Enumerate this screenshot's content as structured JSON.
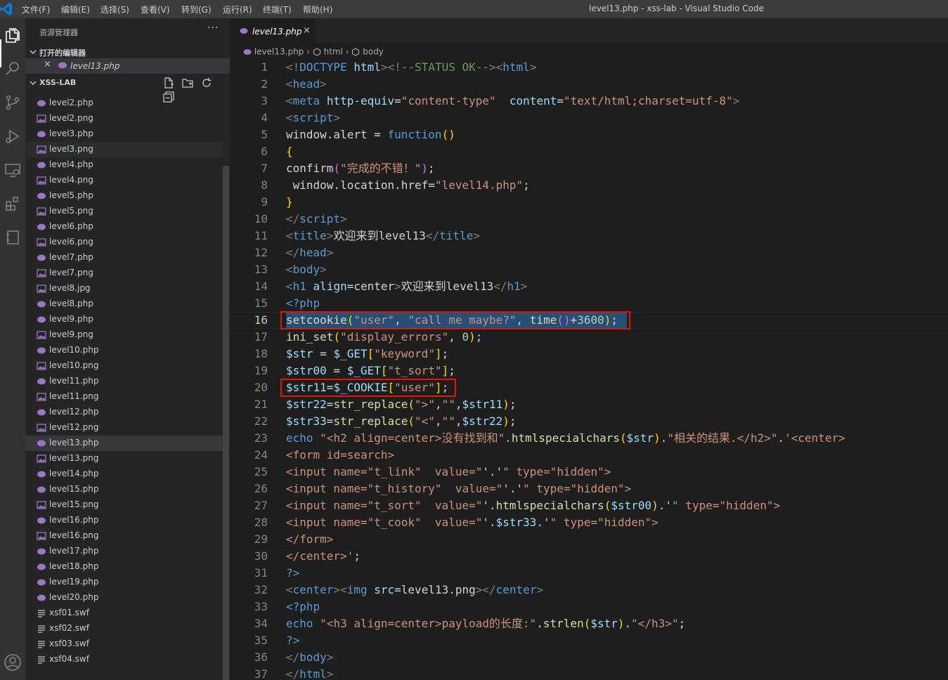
{
  "window": {
    "title": "level13.php - xss-lab - Visual Studio Code"
  },
  "menu": [
    "文件(F)",
    "编辑(E)",
    "选择(S)",
    "查看(V)",
    "转到(G)",
    "运行(R)",
    "终端(T)",
    "帮助(H)"
  ],
  "activity_bar": [
    "explorer-icon",
    "search-icon",
    "source-control-icon",
    "run-debug-icon",
    "remote-explorer-icon",
    "extensions-icon",
    "notebook-icon",
    "account-icon"
  ],
  "sidebar": {
    "title": "资源管理器",
    "more": "···",
    "open_editors": {
      "label": "打开的编辑器",
      "items": [
        {
          "name": "level13.php",
          "close": "×"
        }
      ]
    },
    "folder": {
      "label": "XSS-LAB"
    },
    "files": [
      {
        "name": "level2.php",
        "type": "php"
      },
      {
        "name": "level2.png",
        "type": "img"
      },
      {
        "name": "level3.php",
        "type": "php"
      },
      {
        "name": "level3.png",
        "type": "img"
      },
      {
        "name": "level4.php",
        "type": "php"
      },
      {
        "name": "level4.png",
        "type": "img"
      },
      {
        "name": "level5.php",
        "type": "php"
      },
      {
        "name": "level5.png",
        "type": "img"
      },
      {
        "name": "level6.php",
        "type": "php"
      },
      {
        "name": "level6.png",
        "type": "img"
      },
      {
        "name": "level7.php",
        "type": "php"
      },
      {
        "name": "level7.png",
        "type": "img"
      },
      {
        "name": "level8.jpg",
        "type": "img"
      },
      {
        "name": "level8.php",
        "type": "php"
      },
      {
        "name": "level9.php",
        "type": "php"
      },
      {
        "name": "level9.png",
        "type": "img"
      },
      {
        "name": "level10.php",
        "type": "php"
      },
      {
        "name": "level10.png",
        "type": "img"
      },
      {
        "name": "level11.php",
        "type": "php"
      },
      {
        "name": "level11.png",
        "type": "img"
      },
      {
        "name": "level12.php",
        "type": "php"
      },
      {
        "name": "level12.png",
        "type": "img"
      },
      {
        "name": "level13.php",
        "type": "php"
      },
      {
        "name": "level13.png",
        "type": "img"
      },
      {
        "name": "level14.php",
        "type": "php"
      },
      {
        "name": "level15.php",
        "type": "php"
      },
      {
        "name": "level15.png",
        "type": "img"
      },
      {
        "name": "level16.php",
        "type": "php"
      },
      {
        "name": "level16.png",
        "type": "img"
      },
      {
        "name": "level17.php",
        "type": "php"
      },
      {
        "name": "level18.php",
        "type": "php"
      },
      {
        "name": "level19.php",
        "type": "php"
      },
      {
        "name": "level20.php",
        "type": "php"
      },
      {
        "name": "xsf01.swf",
        "type": "swf"
      },
      {
        "name": "xsf02.swf",
        "type": "swf"
      },
      {
        "name": "xsf03.swf",
        "type": "swf"
      },
      {
        "name": "xsf04.swf",
        "type": "swf"
      }
    ],
    "selected_file": "level13.php",
    "hovered_file": "level3.png"
  },
  "editor": {
    "tab": {
      "name": "level13.php",
      "close": "×"
    },
    "breadcrumb": [
      "level13.php",
      "html",
      "body"
    ],
    "current_line": 16,
    "highlighted_lines": [
      16,
      20
    ],
    "lines": [
      [
        [
          "tg",
          "<!"
        ],
        [
          "tn",
          "DOCTYPE"
        ],
        [
          "pl",
          " "
        ],
        [
          "at",
          "html"
        ],
        [
          "tg",
          "><!--"
        ],
        [
          "cm",
          "STATUS OK"
        ],
        [
          "tg",
          "--><"
        ],
        [
          "tn",
          "html"
        ],
        [
          "tg",
          ">"
        ]
      ],
      [
        [
          "tg",
          "<"
        ],
        [
          "tn",
          "head"
        ],
        [
          "tg",
          ">"
        ]
      ],
      [
        [
          "tg",
          "<"
        ],
        [
          "tn",
          "meta"
        ],
        [
          "pl",
          " "
        ],
        [
          "at",
          "http-equiv"
        ],
        [
          "pl",
          "="
        ],
        [
          "st",
          "\"content-type\""
        ],
        [
          "pl",
          "  "
        ],
        [
          "at",
          "content"
        ],
        [
          "pl",
          "="
        ],
        [
          "st",
          "\"text/html;charset=utf-8\""
        ],
        [
          "tg",
          ">"
        ]
      ],
      [
        [
          "tg",
          "<"
        ],
        [
          "tn",
          "script"
        ],
        [
          "tg",
          ">"
        ]
      ],
      [
        [
          "pl",
          "window.alert = "
        ],
        [
          "kw",
          "function"
        ],
        [
          "br1",
          "()"
        ]
      ],
      [
        [
          "br1",
          "{"
        ]
      ],
      [
        [
          "pl",
          "confirm"
        ],
        [
          "br2",
          "("
        ],
        [
          "st",
          "\"完成的不错！\""
        ],
        [
          "br2",
          ")"
        ],
        [
          "pl",
          ";"
        ]
      ],
      [
        [
          "pl",
          " window.location.href="
        ],
        [
          "st",
          "\"level14.php\""
        ],
        [
          "pl",
          ";"
        ]
      ],
      [
        [
          "br1",
          "}"
        ]
      ],
      [
        [
          "tg",
          "</"
        ],
        [
          "tn",
          "script"
        ],
        [
          "tg",
          ">"
        ]
      ],
      [
        [
          "tg",
          "<"
        ],
        [
          "tn",
          "title"
        ],
        [
          "tg",
          ">"
        ],
        [
          "pl",
          "欢迎来到level13"
        ],
        [
          "tg",
          "</"
        ],
        [
          "tn",
          "title"
        ],
        [
          "tg",
          ">"
        ]
      ],
      [
        [
          "tg",
          "</"
        ],
        [
          "tn",
          "head"
        ],
        [
          "tg",
          ">"
        ]
      ],
      [
        [
          "tg",
          "<"
        ],
        [
          "tn",
          "body"
        ],
        [
          "tg",
          ">"
        ]
      ],
      [
        [
          "tg",
          "<"
        ],
        [
          "tn",
          "h1"
        ],
        [
          "pl",
          " "
        ],
        [
          "at",
          "align"
        ],
        [
          "pl",
          "=center"
        ],
        [
          "tg",
          ">"
        ],
        [
          "pl",
          "欢迎来到level13"
        ],
        [
          "tg",
          "</"
        ],
        [
          "tn",
          "h1"
        ],
        [
          "tg",
          ">"
        ]
      ],
      [
        [
          "ph",
          "<?php"
        ]
      ],
      [
        [
          "fn",
          "setcookie"
        ],
        [
          "br1",
          "("
        ],
        [
          "st",
          "\"user\""
        ],
        [
          "pl",
          ", "
        ],
        [
          "st",
          "\"call me maybe?\""
        ],
        [
          "pl",
          ", "
        ],
        [
          "fn",
          "time"
        ],
        [
          "br2",
          "()"
        ],
        [
          "pl",
          "+"
        ],
        [
          "nu",
          "3600"
        ],
        [
          "br1",
          ")"
        ],
        [
          "pl",
          ";"
        ]
      ],
      [
        [
          "fn",
          "ini_set"
        ],
        [
          "br1",
          "("
        ],
        [
          "st",
          "\"display_errors\""
        ],
        [
          "pl",
          ", "
        ],
        [
          "nu",
          "0"
        ],
        [
          "br1",
          ")"
        ],
        [
          "pl",
          ";"
        ]
      ],
      [
        [
          "vr",
          "$str"
        ],
        [
          "pl",
          " = "
        ],
        [
          "vr",
          "$_GET"
        ],
        [
          "br1",
          "["
        ],
        [
          "st",
          "\"keyword\""
        ],
        [
          "br1",
          "]"
        ],
        [
          "pl",
          ";"
        ]
      ],
      [
        [
          "vr",
          "$str00"
        ],
        [
          "pl",
          " = "
        ],
        [
          "vr",
          "$_GET"
        ],
        [
          "br1",
          "["
        ],
        [
          "st",
          "\"t_sort\""
        ],
        [
          "br1",
          "]"
        ],
        [
          "pl",
          ";"
        ]
      ],
      [
        [
          "vr",
          "$str11"
        ],
        [
          "pl",
          "="
        ],
        [
          "vr",
          "$_COOKIE"
        ],
        [
          "br1",
          "["
        ],
        [
          "st",
          "\"user\""
        ],
        [
          "br1",
          "]"
        ],
        [
          "pl",
          ";"
        ]
      ],
      [
        [
          "vr",
          "$str22"
        ],
        [
          "pl",
          "="
        ],
        [
          "fn",
          "str_replace"
        ],
        [
          "br1",
          "("
        ],
        [
          "st",
          "\">\""
        ],
        [
          "pl",
          ","
        ],
        [
          "st",
          "\"\""
        ],
        [
          "pl",
          ","
        ],
        [
          "vr",
          "$str11"
        ],
        [
          "br1",
          ")"
        ],
        [
          "pl",
          ";"
        ]
      ],
      [
        [
          "vr",
          "$str33"
        ],
        [
          "pl",
          "="
        ],
        [
          "fn",
          "str_replace"
        ],
        [
          "br1",
          "("
        ],
        [
          "st",
          "\"<\""
        ],
        [
          "pl",
          ","
        ],
        [
          "st",
          "\"\""
        ],
        [
          "pl",
          ","
        ],
        [
          "vr",
          "$str22"
        ],
        [
          "br1",
          ")"
        ],
        [
          "pl",
          ";"
        ]
      ],
      [
        [
          "kw",
          "echo"
        ],
        [
          "pl",
          " "
        ],
        [
          "st",
          "\"<h2 align=center>没有找到和\""
        ],
        [
          "pl",
          "."
        ],
        [
          "fn",
          "htmlspecialchars"
        ],
        [
          "br1",
          "("
        ],
        [
          "vr",
          "$str"
        ],
        [
          "br1",
          ")"
        ],
        [
          "pl",
          "."
        ],
        [
          "st",
          "\"相关的结果.</h2>\""
        ],
        [
          "pl",
          "."
        ],
        [
          "st",
          "'<center>"
        ]
      ],
      [
        [
          "st",
          "<form id=search>"
        ]
      ],
      [
        [
          "st",
          "<input name=\"t_link\"  value=\""
        ],
        [
          "pl",
          "'.'"
        ],
        [
          "st",
          "\" type=\"hidden\">"
        ]
      ],
      [
        [
          "st",
          "<input name=\"t_history\"  value=\""
        ],
        [
          "pl",
          "'.'"
        ],
        [
          "st",
          "\" type=\"hidden\">"
        ]
      ],
      [
        [
          "st",
          "<input name=\"t_sort\"  value=\""
        ],
        [
          "pl",
          "'."
        ],
        [
          "fn",
          "htmlspecialchars"
        ],
        [
          "br1",
          "("
        ],
        [
          "vr",
          "$str00"
        ],
        [
          "br1",
          ")"
        ],
        [
          "pl",
          ".'"
        ],
        [
          "st",
          "\" type=\"hidden\">"
        ]
      ],
      [
        [
          "st",
          "<input name=\"t_cook\"  value=\""
        ],
        [
          "pl",
          "'."
        ],
        [
          "vr",
          "$str33"
        ],
        [
          "pl",
          ".'"
        ],
        [
          "st",
          "\" type=\"hidden\">"
        ]
      ],
      [
        [
          "st",
          "</form>"
        ]
      ],
      [
        [
          "st",
          "</center>'"
        ],
        [
          "pl",
          ";"
        ]
      ],
      [
        [
          "ph",
          "?>"
        ]
      ],
      [
        [
          "tg",
          "<"
        ],
        [
          "tn",
          "center"
        ],
        [
          "tg",
          "><"
        ],
        [
          "tn",
          "img"
        ],
        [
          "pl",
          " "
        ],
        [
          "at",
          "src"
        ],
        [
          "pl",
          "=level13.png"
        ],
        [
          "tg",
          "></"
        ],
        [
          "tn",
          "center"
        ],
        [
          "tg",
          ">"
        ]
      ],
      [
        [
          "ph",
          "<?php"
        ]
      ],
      [
        [
          "kw",
          "echo"
        ],
        [
          "pl",
          " "
        ],
        [
          "st",
          "\"<h3 align=center>payload的长度:\""
        ],
        [
          "pl",
          "."
        ],
        [
          "fn",
          "strlen"
        ],
        [
          "br1",
          "("
        ],
        [
          "vr",
          "$str"
        ],
        [
          "br1",
          ")"
        ],
        [
          "pl",
          "."
        ],
        [
          "st",
          "\"</h3>\""
        ],
        [
          "pl",
          ";"
        ]
      ],
      [
        [
          "ph",
          "?>"
        ]
      ],
      [
        [
          "tg",
          "</"
        ],
        [
          "tn",
          "body"
        ],
        [
          "tg",
          ">"
        ]
      ],
      [
        [
          "tg",
          "</"
        ],
        [
          "tn",
          "html"
        ],
        [
          "tg",
          ">"
        ]
      ]
    ]
  },
  "colors": {
    "accent": "#007acc",
    "highlight_box": "#e51400",
    "selection": "#264f78",
    "php_icon": "#a074c4"
  }
}
